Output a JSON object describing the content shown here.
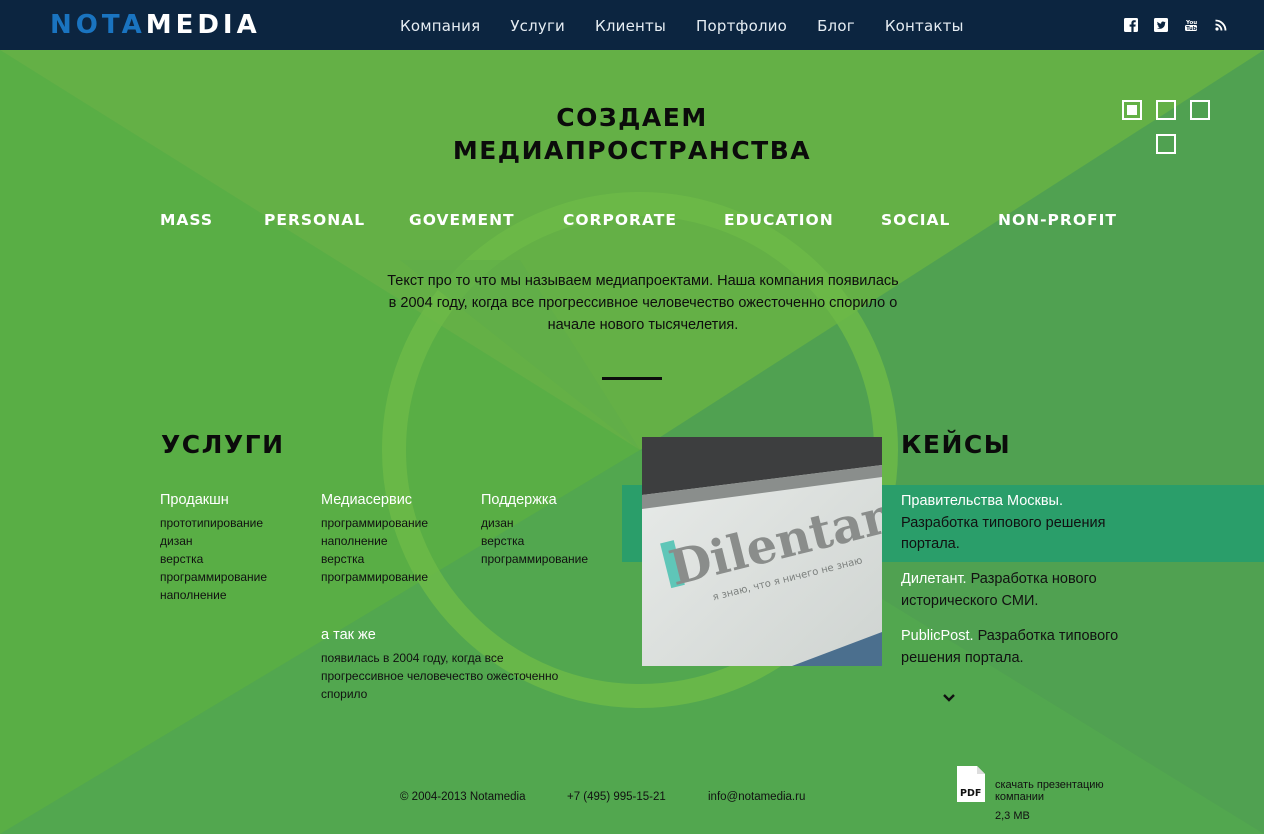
{
  "header": {
    "logo_part1": "NOTA",
    "logo_part2": "MEDIA",
    "nav": [
      "Компания",
      "Услуги",
      "Клиенты",
      "Портфолио",
      "Блог",
      "Контакты"
    ],
    "social_icons": [
      "facebook-icon",
      "twitter-icon",
      "youtube-icon",
      "rss-icon"
    ]
  },
  "hero": {
    "title_line1": "СОЗДАЕМ",
    "title_line2": "МЕДИАПРОСТРАНСТВА",
    "slider_dots_count": 4,
    "slider_active_index": 0,
    "categories": [
      "MASS",
      "PERSONAL",
      "GOVEMENT",
      "CORPORATE",
      "EDUCATION",
      "SOCIAL",
      "NON-PROFIT"
    ],
    "intro_line1": "Текст про то что мы называем медиапроектами. Наша компания появилась",
    "intro_line2": "в 2004 году, когда все прогрессивное человечество ожесточенно спорило о",
    "intro_line3": "начале нового тысячелетия."
  },
  "services": {
    "title": "УСЛУГИ",
    "columns": [
      {
        "heading": "Продакшн",
        "items": [
          "прототипирование",
          "дизан",
          "верстка",
          "программирование",
          "наполнение"
        ]
      },
      {
        "heading": "Медиасервис",
        "items": [
          "программирование",
          "наполнение",
          "верстка",
          "программирование"
        ]
      },
      {
        "heading": "Поддержка",
        "items": [
          "дизан",
          "верстка",
          "программирование"
        ]
      }
    ],
    "also_heading": "а так же",
    "also_lines": [
      "появилась в 2004 году, когда все",
      "прогрессивное человечество ожесточенно",
      "спорило"
    ]
  },
  "photo": {
    "brand_text": "Dilentant",
    "tagline": "я знаю, что я ничего не знаю"
  },
  "cases": {
    "title": "КЕЙСЫ",
    "items": [
      {
        "name": "Правительства Москвы.",
        "desc": "Разработка типового решения портала."
      },
      {
        "name": "Дилетант.",
        "desc": "Разработка нового исторического СМИ."
      },
      {
        "name": "PublicPost.",
        "desc": "Разработка типового решения портала."
      }
    ]
  },
  "footer": {
    "copyright": "© 2004-2013 Notamedia",
    "phone": "+7 (495) 995-15-21",
    "email": "info@notamedia.ru",
    "pdf_badge": "PDF",
    "pdf_label_line1": "скачать презентацию",
    "pdf_label_line2": "компании",
    "pdf_size": "2,3 MB"
  },
  "colors": {
    "header_bg": "#0c2540",
    "page_bg": "#66b04a",
    "band": "#2a9e6a",
    "logo_accent": "#1a74c0"
  }
}
